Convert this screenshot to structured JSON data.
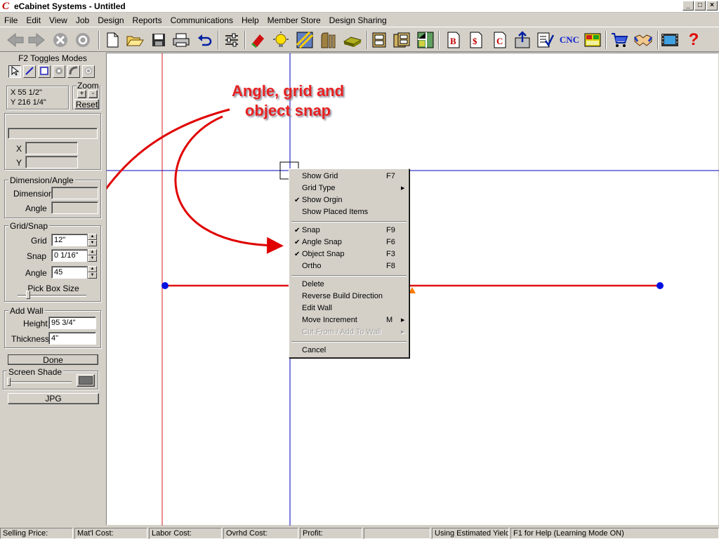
{
  "window": {
    "title": "eCabinet Systems - Untitled",
    "logo_letter": "C",
    "min": "_",
    "max": "□",
    "close": "×"
  },
  "menu": [
    "File",
    "Edit",
    "View",
    "Job",
    "Design",
    "Reports",
    "Communications",
    "Help",
    "Member Store",
    "Design Sharing"
  ],
  "toolbar": {
    "cnc_label": "CNC",
    "bid_label": "B",
    "price_label": "$",
    "cut_label": "C",
    "help_label": "?"
  },
  "left_panel": {
    "modes_label": "F2 Toggles Modes",
    "coords": {
      "x": "X 55 1/2\"",
      "y": "Y 216 1/4\""
    },
    "zoom": {
      "label": "Zoom",
      "plus": "+",
      "minus": "-",
      "reset": "Reset"
    },
    "point": {
      "x_label": "X",
      "y_label": "Y"
    },
    "dimension_angle": {
      "title": "Dimension/Angle",
      "dimension_label": "Dimension",
      "angle_label": "Angle"
    },
    "grid_snap": {
      "title": "Grid/Snap",
      "grid_label": "Grid",
      "grid_value": "12\"",
      "snap_label": "Snap",
      "snap_value": "0 1/16\"",
      "angle_label": "Angle",
      "angle_value": "45",
      "pick_box_label": "Pick Box Size"
    },
    "add_wall": {
      "title": "Add Wall",
      "height_label": "Height",
      "height_value": "95 3/4\"",
      "thickness_label": "Thickness",
      "thickness_value": "4\""
    },
    "done": "Done",
    "screen_shade": "Screen Shade",
    "jpg": "JPG"
  },
  "annotation": {
    "line1": "Angle, grid and",
    "line2": "object snap"
  },
  "context_menu": {
    "items": [
      {
        "label": "Show Grid",
        "shortcut": "F7",
        "checked": "",
        "arrow": ""
      },
      {
        "label": "Grid Type",
        "shortcut": "",
        "checked": "",
        "arrow": "▶"
      },
      {
        "label": "Show Orgin",
        "shortcut": "",
        "checked": "✔",
        "arrow": ""
      },
      {
        "label": "Show Placed Items",
        "shortcut": "",
        "checked": "",
        "arrow": ""
      },
      {
        "label": "Snap",
        "shortcut": "F9",
        "checked": "✔",
        "arrow": ""
      },
      {
        "label": "Angle Snap",
        "shortcut": "F6",
        "checked": "✔",
        "arrow": ""
      },
      {
        "label": "Object Snap",
        "shortcut": "F3",
        "checked": "✔",
        "arrow": ""
      },
      {
        "label": "Ortho",
        "shortcut": "F8",
        "checked": "",
        "arrow": ""
      },
      {
        "label": "Delete",
        "shortcut": "",
        "checked": "",
        "arrow": ""
      },
      {
        "label": "Reverse Build Direction",
        "shortcut": "",
        "checked": "",
        "arrow": ""
      },
      {
        "label": "Edit Wall",
        "shortcut": "",
        "checked": "",
        "arrow": ""
      },
      {
        "label": "Move Increment",
        "shortcut": "M",
        "checked": "",
        "arrow": "▶"
      },
      {
        "label": "Cut From / Add To Wall",
        "shortcut": "",
        "checked": "",
        "arrow": "▶"
      },
      {
        "label": "Cancel",
        "shortcut": "",
        "checked": "",
        "arrow": ""
      }
    ]
  },
  "status": [
    "Selling Price:",
    "Mat'l Cost:",
    "Labor Cost:",
    "Ovrhd Cost:",
    "Profit:",
    "",
    "Using Estimated Yield",
    "F1 for Help (Learning Mode ON)"
  ],
  "colors": {
    "wall_line": "#e01010",
    "guide_line": "#0000c0",
    "origin_line": "#d02020",
    "endpoint": "#0010e0",
    "marker": "#ff7a00",
    "annotation": "#e82020"
  }
}
